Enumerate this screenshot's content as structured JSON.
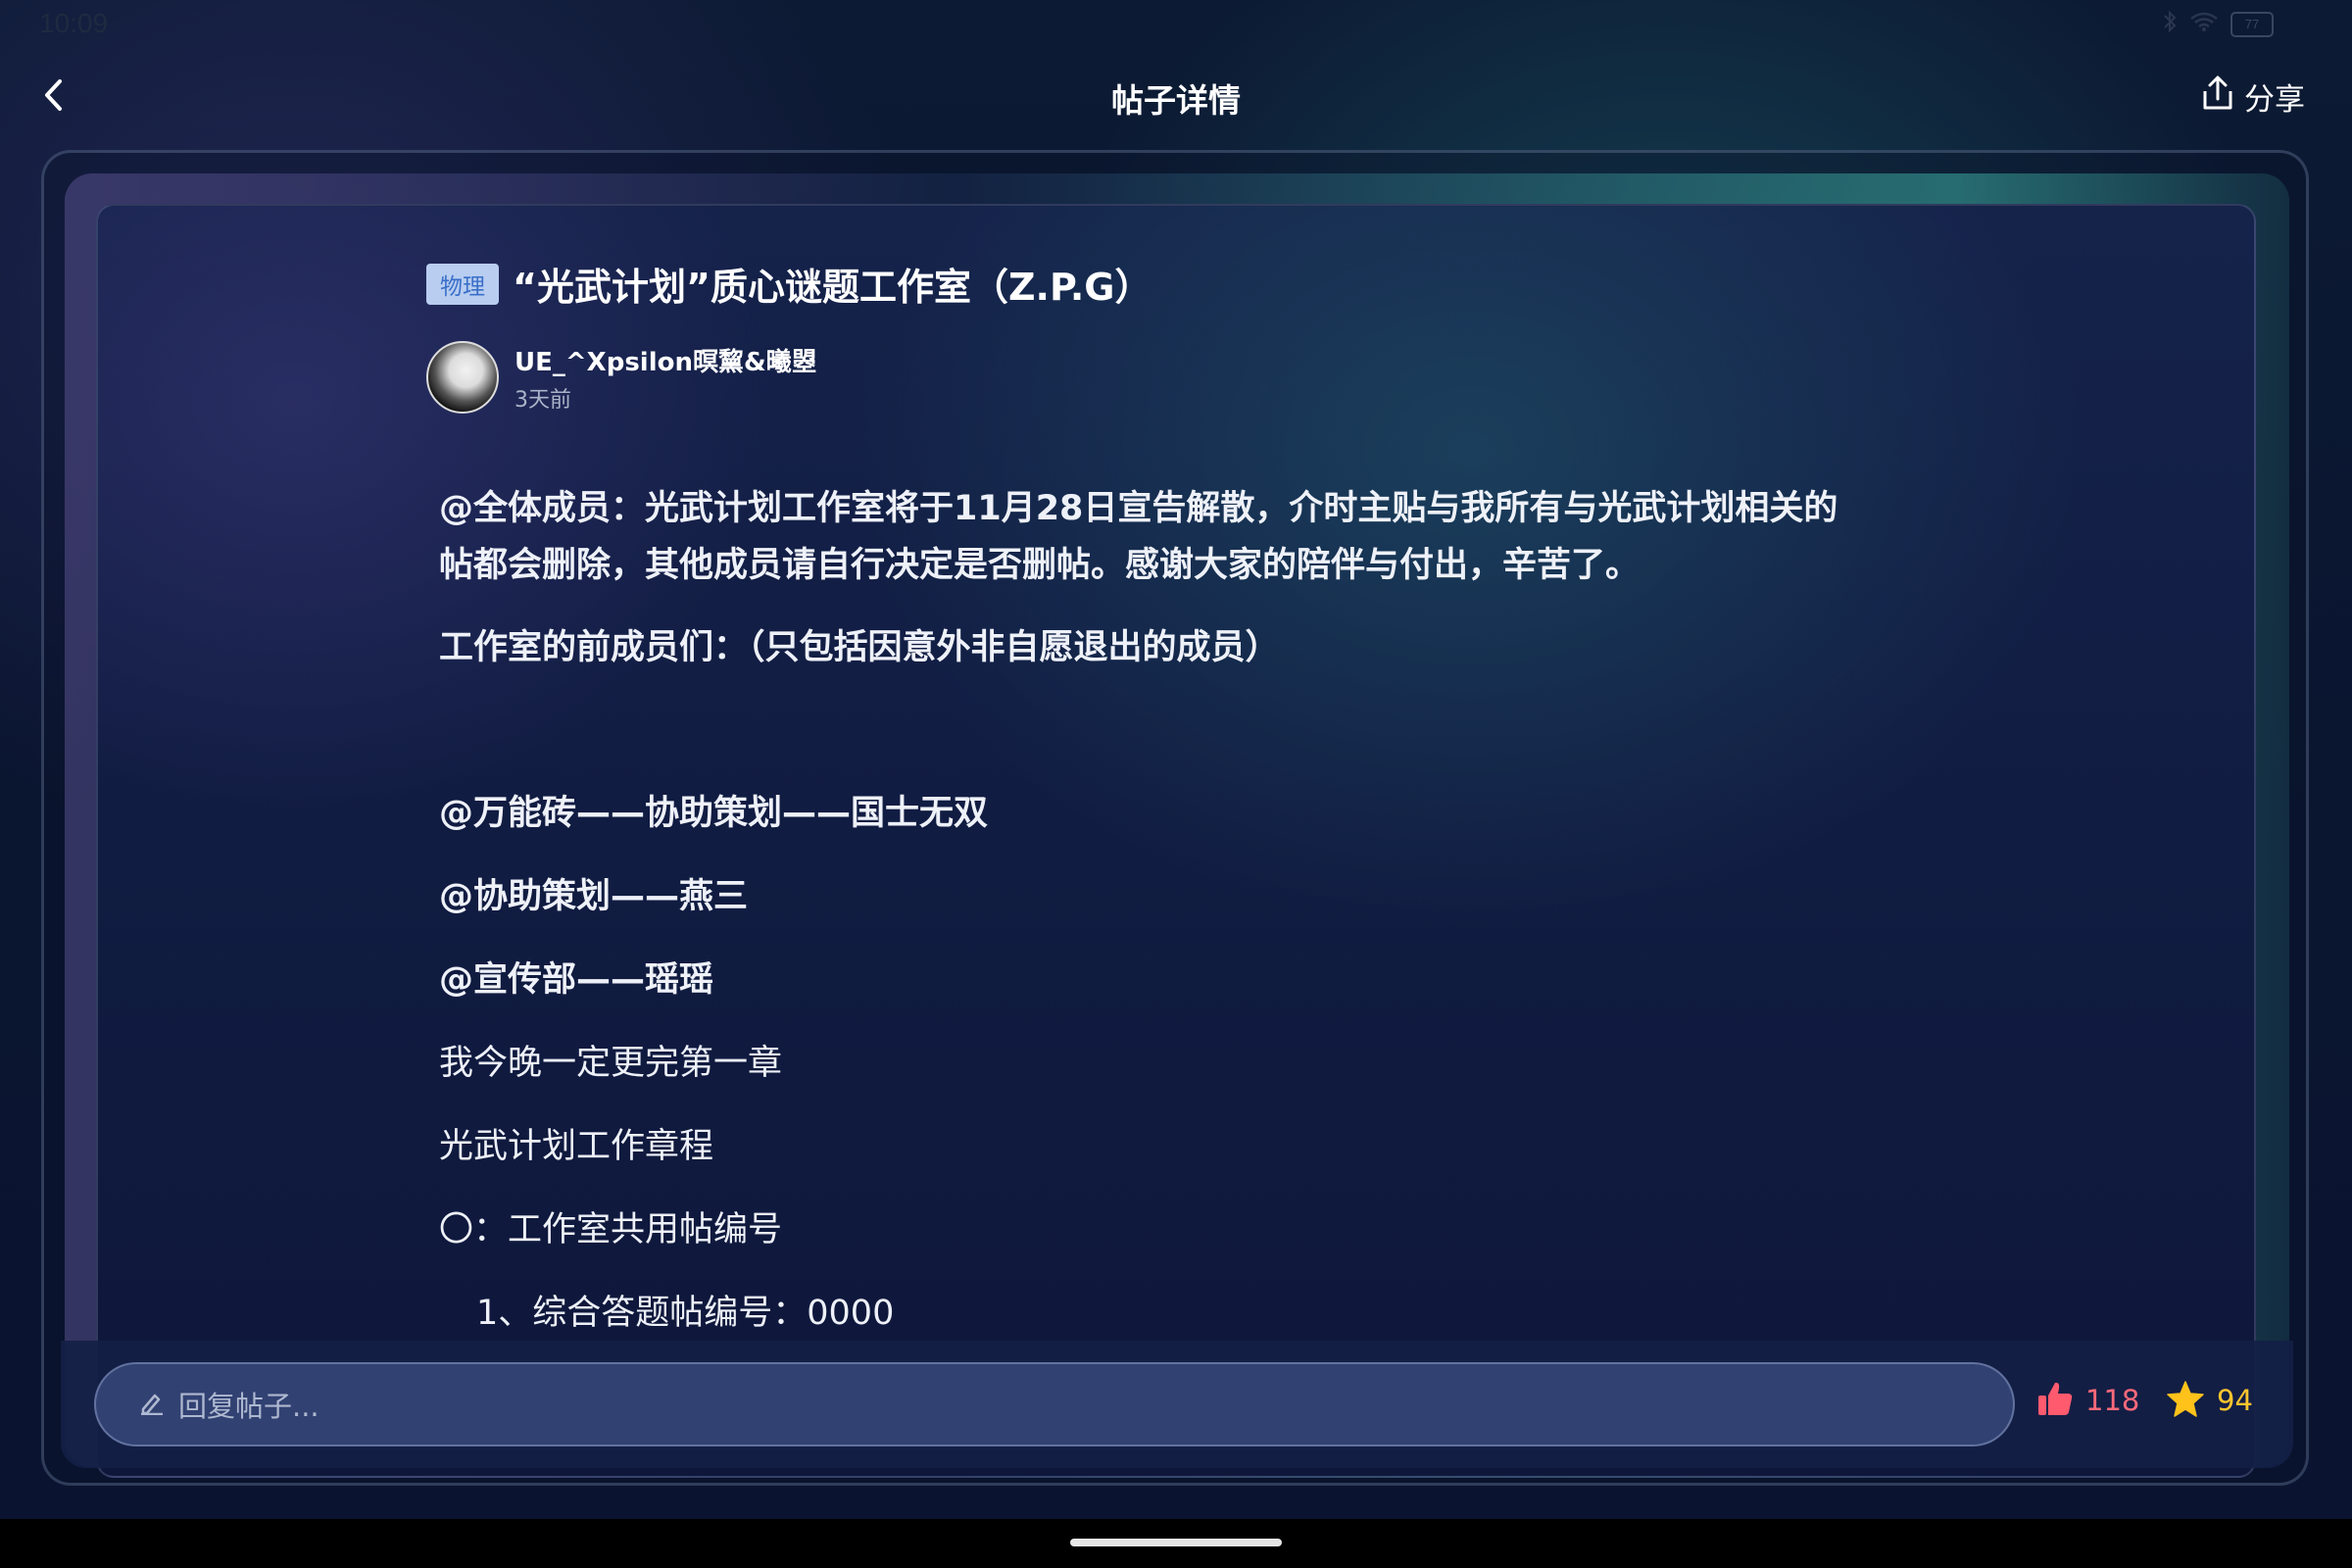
{
  "status_bar": {
    "time": "10:09",
    "battery": "77"
  },
  "header": {
    "title": "帖子详情",
    "share_label": "分享"
  },
  "post": {
    "tag": "物理",
    "title": "“光武计划”质心谜题工作室（Z.P.G）",
    "author": "UE_^Xpsilon暝黧&曦曌",
    "time": "3天前",
    "paragraphs": [
      "@全体成员：光武计划工作室将于11月28日宣告解散，介时主贴与我所有与光武计划相关的",
      "帖都会删除，其他成员请自行决定是否删帖。感谢大家的陪伴与付出，辛苦了。",
      "工作室的前成员们：（只包括因意外非自愿退出的成员）",
      "@万能砖——协助策划——国士无双",
      "@协助策划——燕三",
      "@宣传部——瑶瑶",
      "我今晚一定更完第一章",
      "光武计划工作章程",
      "〇：工作室共用帖编号",
      "1、综合答题帖编号：0000"
    ]
  },
  "bottom_bar": {
    "reply_placeholder": "回复帖子...",
    "like_count": "118",
    "fav_count": "94",
    "like_color": "#ff5a6e",
    "fav_color": "#ffc21a"
  },
  "icons": {
    "back": "chevron-left-icon",
    "share": "share-icon",
    "pencil": "pencil-icon",
    "like": "thumbs-up-icon",
    "favorite": "star-icon"
  }
}
